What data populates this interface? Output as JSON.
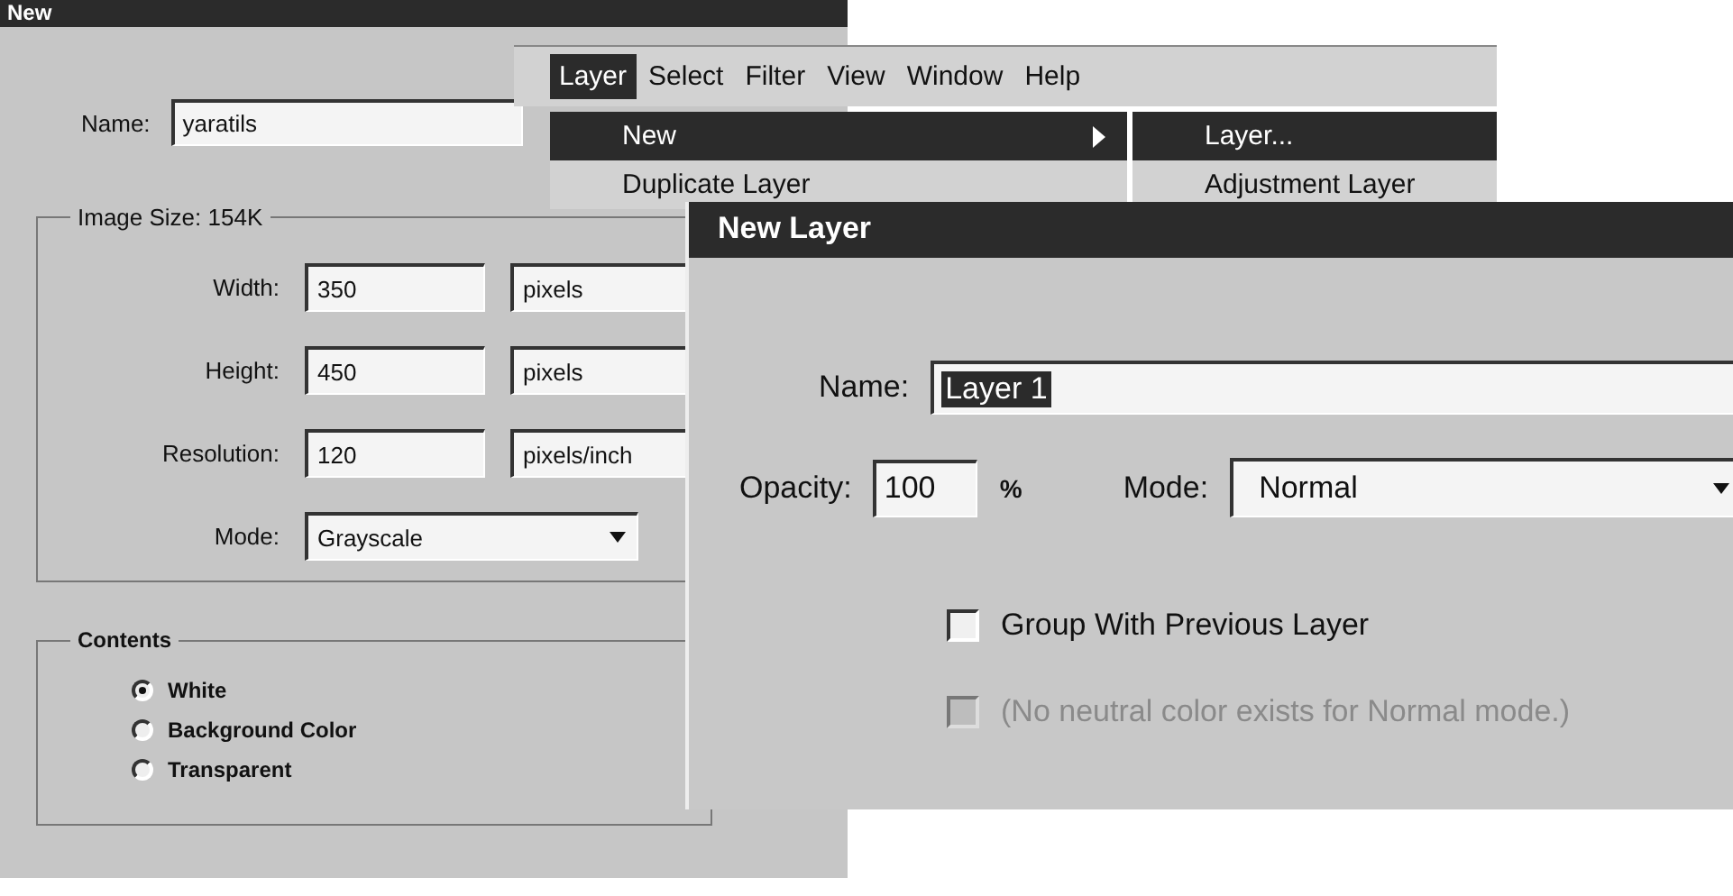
{
  "new_dialog": {
    "title": "New",
    "name": {
      "label": "Name:",
      "value": "yaratils"
    },
    "image_size": {
      "label": "Image Size: 154K",
      "fields": [
        {
          "label": "Width:",
          "value": "350",
          "unit": "pixels"
        },
        {
          "label": "Height:",
          "value": "450",
          "unit": "pixels"
        },
        {
          "label": "Resolution:",
          "value": "120",
          "unit": "pixels/inch"
        }
      ],
      "mode": {
        "label": "Mode:",
        "value": "Grayscale"
      }
    },
    "contents": {
      "label": "Contents",
      "options": [
        {
          "label": "White",
          "selected": true
        },
        {
          "label": "Background Color",
          "selected": false
        },
        {
          "label": "Transparent",
          "selected": false
        }
      ]
    }
  },
  "menu": {
    "menu_bar": [
      {
        "label": "Layer",
        "selected": true
      },
      {
        "label": "Select",
        "selected": false
      },
      {
        "label": "Filter",
        "selected": false
      },
      {
        "label": "View",
        "selected": false
      },
      {
        "label": "Window",
        "selected": false
      },
      {
        "label": "Help",
        "selected": false
      }
    ],
    "dropdown": [
      {
        "label": "New",
        "selected": true,
        "submenu": true
      },
      {
        "label": "Duplicate Layer",
        "selected": false,
        "submenu": false
      }
    ],
    "submenu": [
      {
        "label": "Layer...",
        "selected": true
      },
      {
        "label": "Adjustment Layer",
        "selected": false
      }
    ]
  },
  "new_layer_dialog": {
    "title": "New Layer",
    "name": {
      "label": "Name:",
      "value": "Layer 1",
      "selected": true
    },
    "opacity": {
      "label": "Opacity:",
      "value": "100",
      "unit": "%"
    },
    "mode": {
      "label": "Mode:",
      "value": "Normal"
    },
    "checkboxes": [
      {
        "label": "Group With Previous Layer",
        "checked": false,
        "disabled": false
      },
      {
        "label": "(No neutral color exists for Normal mode.)",
        "checked": false,
        "disabled": true
      }
    ]
  }
}
